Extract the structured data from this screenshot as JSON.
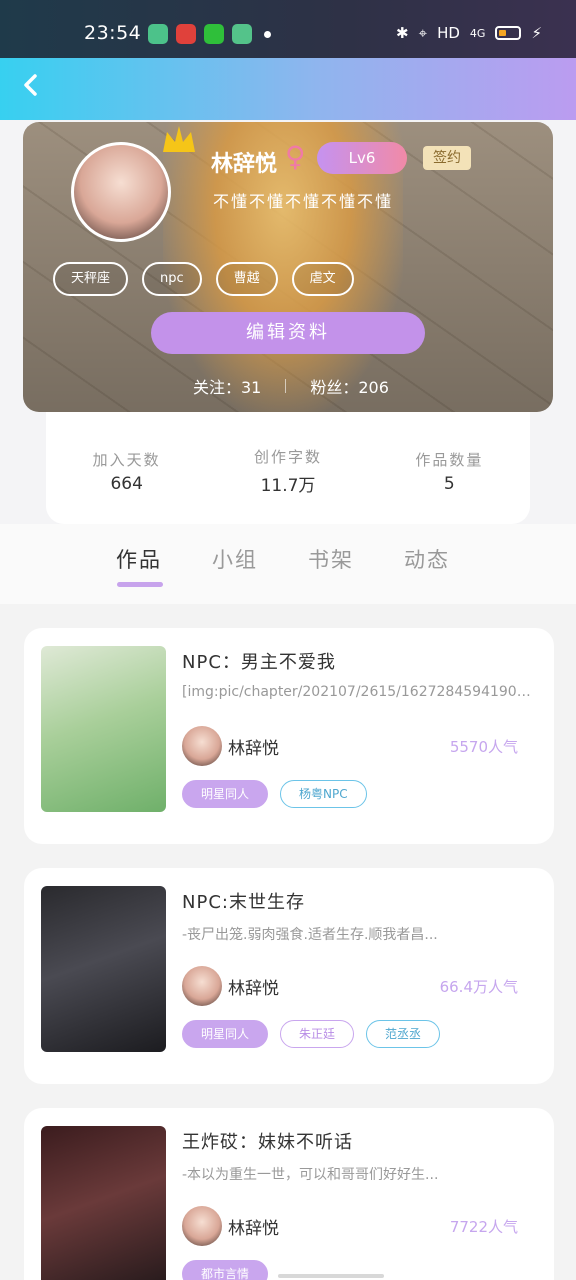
{
  "status": {
    "time": "23:54",
    "network": "HD",
    "signal": "4G"
  },
  "profile": {
    "name": "林辞悦",
    "level": "Lv6",
    "signed": "签约",
    "bio": "不懂不懂不懂不懂不懂",
    "tags": [
      "天秤座",
      "npc",
      "曹越",
      "虐文"
    ],
    "edit_label": "编辑资料",
    "following_label": "关注：31",
    "followers_label": "粉丝：206"
  },
  "stats": [
    {
      "label": "加入天数",
      "value": "664"
    },
    {
      "label": "创作字数",
      "value": "11.7万"
    },
    {
      "label": "作品数量",
      "value": "5"
    }
  ],
  "tabs": [
    "作品",
    "小组",
    "书架",
    "动态"
  ],
  "works": [
    {
      "title": "NPC：男主不爱我",
      "desc": "[img:pic/chapter/202107/2615/1627284594190-U...",
      "author": "林辞悦",
      "popularity": "5570人气",
      "tags": [
        "明星同人",
        "杨粤NPC"
      ]
    },
    {
      "title": "NPC:末世生存",
      "desc": "-丧尸出笼.弱肉强食.适者生存.顺我者昌...",
      "author": "林辞悦",
      "popularity": "66.4万人气",
      "tags": [
        "明星同人",
        "朱正廷",
        "范丞丞"
      ]
    },
    {
      "title": "王炸砹：妹妹不听话",
      "desc": "-本以为重生一世，可以和哥哥们好好生...",
      "author": "林辞悦",
      "popularity": "7722人气",
      "tags": [
        "都市言情"
      ]
    }
  ]
}
